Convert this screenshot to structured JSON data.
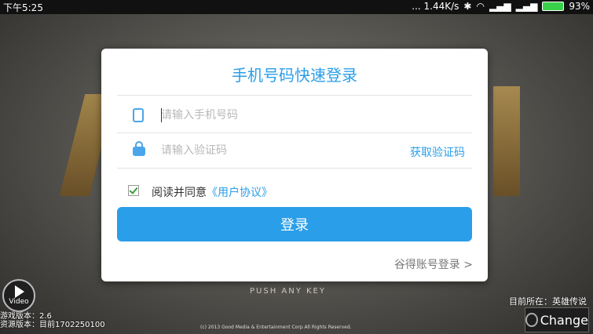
{
  "statusbar": {
    "time": "下午5:25",
    "speed": "... 1.44K/s",
    "battery": "93%"
  },
  "background": {
    "video_label": "Video",
    "version_game": "游戏版本：2.6",
    "version_res": "资源版本：目前1702250100",
    "push_any_key": "PUSH ANY KEY",
    "copyright": "(c) 2013 Good Media & Entertainment Corp All Rights Reserved.",
    "server": "目前所在：英雄传说",
    "change_label": "Change"
  },
  "dialog": {
    "title": "手机号码快速登录",
    "phone_placeholder": "请输入手机号码",
    "code_placeholder": "请输入验证码",
    "get_code": "获取验证码",
    "agree_text": "阅读并同意",
    "agree_link": "《用户协议》",
    "login_button": "登录",
    "alt_login": "谷得账号登录 >"
  },
  "colors": {
    "accent": "#2a9ee8"
  }
}
